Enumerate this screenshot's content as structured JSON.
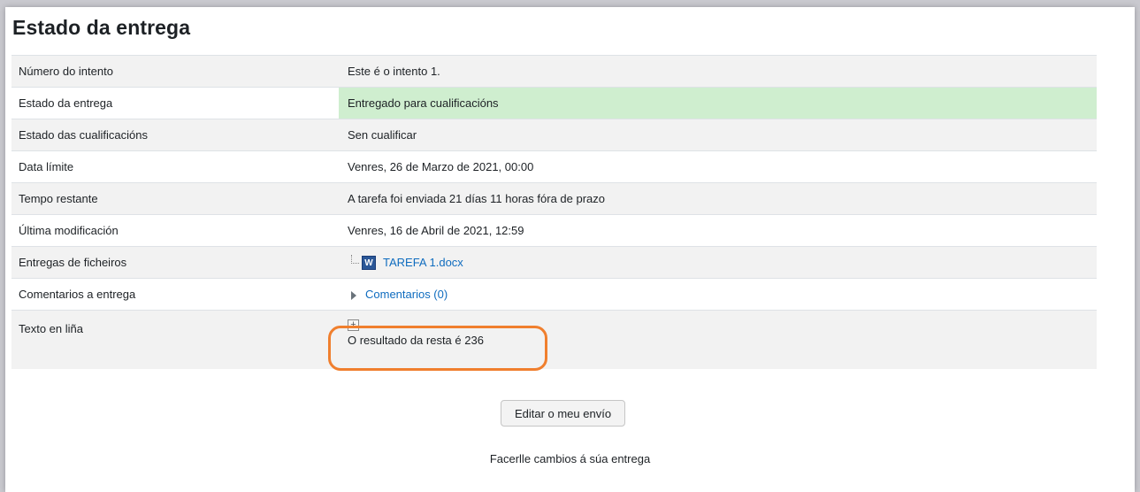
{
  "page": {
    "title": "Estado da entrega",
    "edit_button": "Editar o meu envío",
    "edit_hint": "Facerlle cambios á súa entrega"
  },
  "rows": {
    "attempt": {
      "label": "Número do intento",
      "value": "Este é o intento 1."
    },
    "submission_status": {
      "label": "Estado da entrega",
      "value": "Entregado para cualificacións"
    },
    "grading_status": {
      "label": "Estado das cualificacións",
      "value": "Sen cualificar"
    },
    "due_date": {
      "label": "Data límite",
      "value": "Venres, 26 de Marzo de 2021, 00:00"
    },
    "time_remaining": {
      "label": "Tempo restante",
      "value": "A tarefa foi enviada 21 días 11 horas fóra de prazo"
    },
    "last_modified": {
      "label": "Última modificación",
      "value": "Venres, 16 de Abril de 2021, 12:59"
    },
    "file_submissions": {
      "label": "Entregas de ficheiros",
      "file_name": "TAREFA 1.docx",
      "icon": "word-icon"
    },
    "submission_comments": {
      "label": "Comentarios a entrega",
      "link": "Comentarios (0)"
    },
    "online_text": {
      "label": "Texto en liña",
      "value": "O resultado da resta é 236"
    }
  },
  "colors": {
    "submitted_bg": "#cfeecf",
    "link": "#0f6cbf",
    "highlight": "#f07f2e"
  }
}
